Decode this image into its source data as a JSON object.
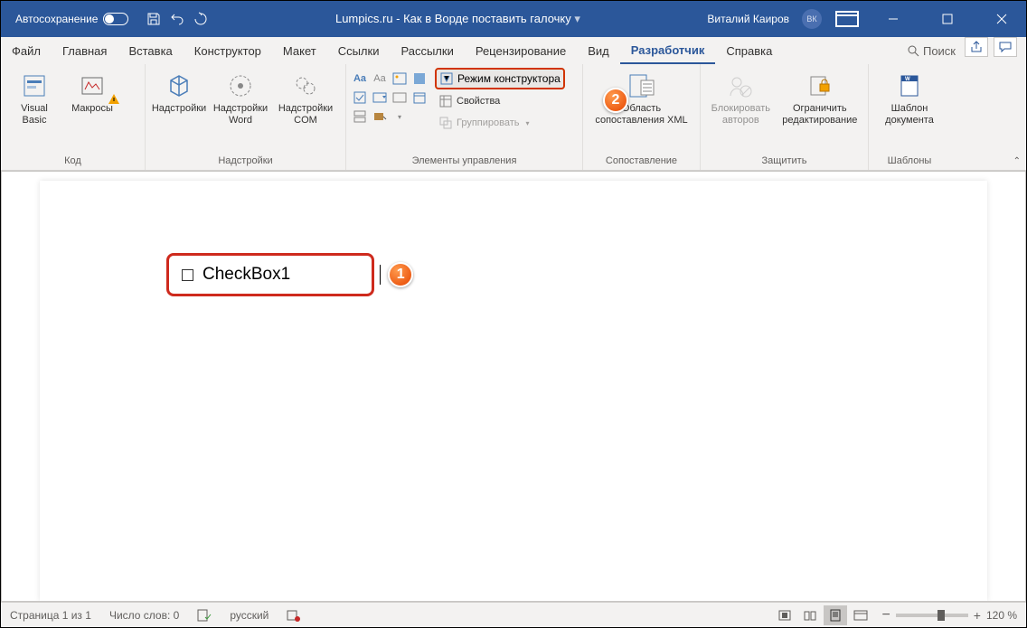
{
  "titlebar": {
    "autosave": "Автосохранение",
    "title": "Lumpics.ru - Как в Ворде поставить галочку",
    "user": "Виталий Каиров",
    "initials": "ВК"
  },
  "tabs": {
    "file": "Файл",
    "home": "Главная",
    "insert": "Вставка",
    "design": "Конструктор",
    "layout": "Макет",
    "references": "Ссылки",
    "mailings": "Рассылки",
    "review": "Рецензирование",
    "view": "Вид",
    "developer": "Разработчик",
    "help": "Справка",
    "search": "Поиск"
  },
  "groups": {
    "code": "Код",
    "addins": "Надстройки",
    "controls": "Элементы управления",
    "mapping": "Сопоставление",
    "protect": "Защитить",
    "templates": "Шаблоны"
  },
  "buttons": {
    "visualbasic": "Visual Basic",
    "macros": "Макросы",
    "addins": "Надстройки",
    "wordaddins": "Надстройки Word",
    "comaddins": "Надстройки COM",
    "designmode": "Режим конструктора",
    "properties": "Свойства",
    "group": "Группировать",
    "xmlmapping": "Область сопоставления XML",
    "blockauthors": "Блокировать авторов",
    "restrictedit": "Ограничить редактирование",
    "doctemplate": "Шаблон документа"
  },
  "doc": {
    "checkbox_label": "CheckBox1"
  },
  "badges": {
    "one": "1",
    "two": "2"
  },
  "status": {
    "page": "Страница 1 из 1",
    "words": "Число слов: 0",
    "lang": "русский",
    "zoom": "120 %"
  }
}
